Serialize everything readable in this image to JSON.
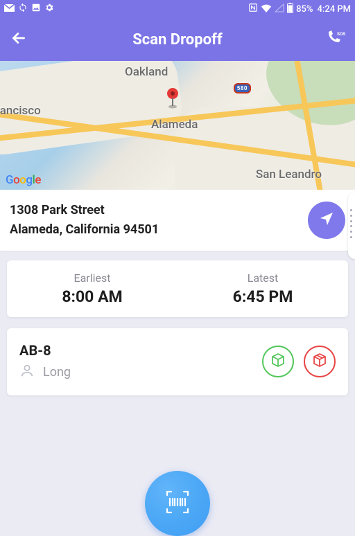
{
  "status": {
    "battery_pct": "85%",
    "clock": "4:24 PM"
  },
  "header": {
    "title": "Scan Dropoff"
  },
  "map": {
    "cities": {
      "oakland": "Oakland",
      "alameda": "Alameda",
      "san_leandro": "San Leandro",
      "francisco": "rancisco"
    },
    "hwy_shield": "580",
    "attribution": "Google"
  },
  "address": {
    "line1": "1308 Park Street",
    "line2": "Alameda, California 94501"
  },
  "time_window": {
    "earliest_label": "Earliest",
    "earliest_value": "8:00 AM",
    "latest_label": "Latest",
    "latest_value": "6:45 PM"
  },
  "package": {
    "code": "AB-8",
    "recipient": "Long"
  }
}
